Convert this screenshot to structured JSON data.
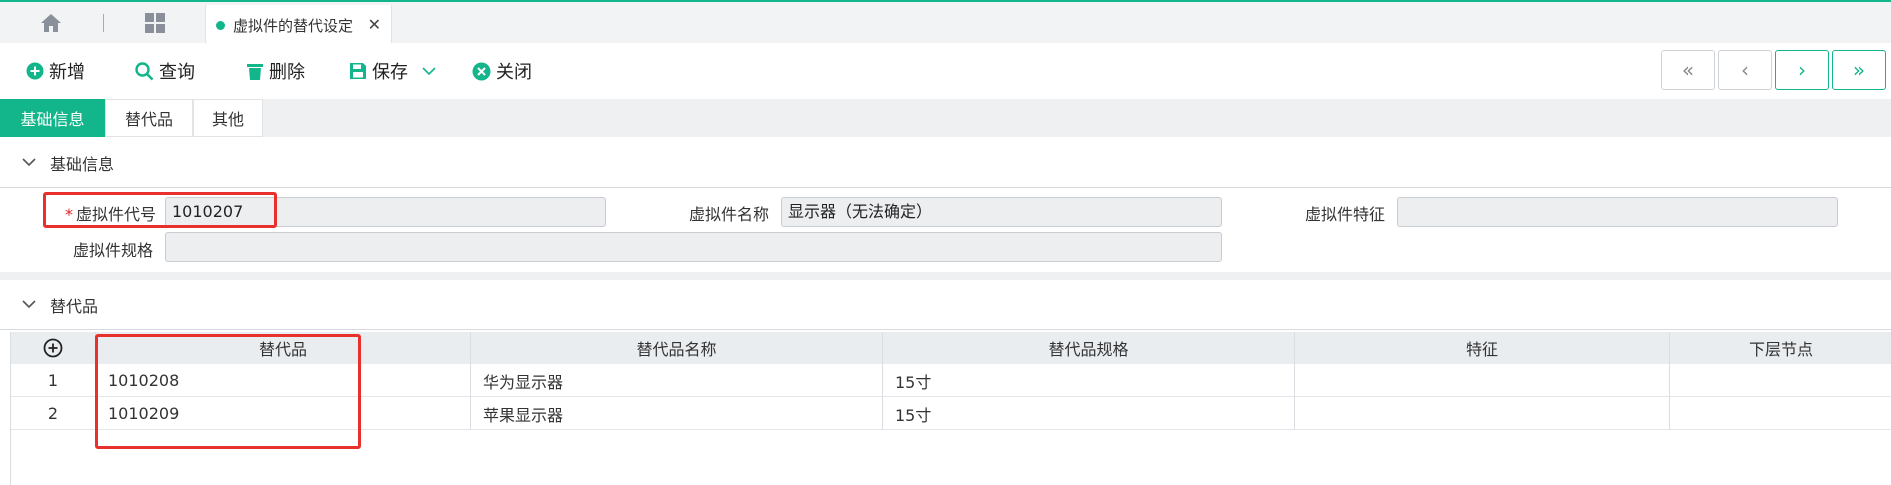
{
  "tabbar": {
    "doc_tab_label": "虚拟件的替代设定",
    "close_glyph": "✕"
  },
  "toolbar": {
    "new_label": "新增",
    "query_label": "查询",
    "delete_label": "删除",
    "save_label": "保存",
    "close_label": "关闭"
  },
  "nav": {
    "first": "«",
    "prev": "‹",
    "next": "›",
    "last": "»"
  },
  "section_tabs": [
    "基础信息",
    "替代品",
    "其他"
  ],
  "sections": {
    "basic_title": "基础信息",
    "sub_title": "替代品"
  },
  "form": {
    "required_mark": "*",
    "code_label": "虚拟件代号",
    "code_value": "1010207",
    "name_label": "虚拟件名称",
    "name_value": "显示器（无法确定）",
    "feature_label": "虚拟件特征",
    "feature_value": "",
    "spec_label": "虚拟件规格",
    "spec_value": ""
  },
  "grid": {
    "columns": [
      "替代品",
      "替代品名称",
      "替代品规格",
      "特征",
      "下层节点"
    ],
    "rows": [
      {
        "index": "1",
        "code": "1010208",
        "name": "华为显示器",
        "spec": "15寸",
        "feature": "",
        "child": ""
      },
      {
        "index": "2",
        "code": "1010209",
        "name": "苹果显示器",
        "spec": "15寸",
        "feature": "",
        "child": ""
      }
    ]
  },
  "colors": {
    "accent": "#13b58b",
    "highlight": "#e8302c"
  }
}
